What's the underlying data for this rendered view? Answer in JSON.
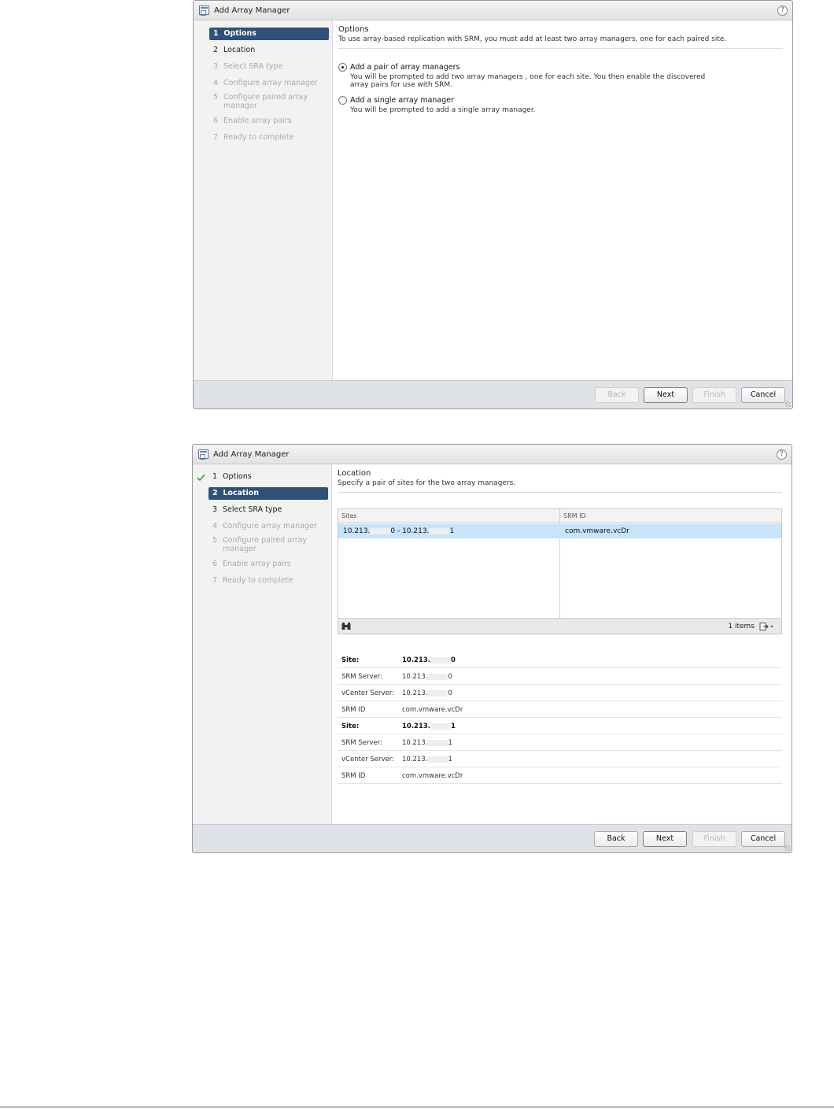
{
  "dialogs": [
    {
      "title": "Add Array Manager",
      "help_symbol": "?",
      "steps": [
        {
          "num": "1",
          "label": "Options"
        },
        {
          "num": "2",
          "label": "Location"
        },
        {
          "num": "3",
          "label": "Select SRA type"
        },
        {
          "num": "4",
          "label": "Configure array manager"
        },
        {
          "num": "5",
          "label": "Configure paired array manager"
        },
        {
          "num": "6",
          "label": "Enable array pairs"
        },
        {
          "num": "7",
          "label": "Ready to complete"
        }
      ],
      "section_title": "Options",
      "section_desc": "To use array-based replication with SRM, you must add at least two array managers, one for each paired site.",
      "options": [
        {
          "label": "Add a pair of array managers",
          "desc": "You will be prompted to add two array managers , one for each site. You then enable the discovered array pairs for use with SRM.",
          "checked": true
        },
        {
          "label": "Add a single array manager",
          "desc": "You will be prompted to add a single array manager.",
          "checked": false
        }
      ],
      "buttons": {
        "back": "Back",
        "next": "Next",
        "finish": "Finish",
        "cancel": "Cancel"
      }
    },
    {
      "title": "Add Array Manager",
      "help_symbol": "?",
      "steps": [
        {
          "num": "1",
          "label": "Options"
        },
        {
          "num": "2",
          "label": "Location"
        },
        {
          "num": "3",
          "label": "Select SRA type"
        },
        {
          "num": "4",
          "label": "Configure array manager"
        },
        {
          "num": "5",
          "label": "Configure paired array manager"
        },
        {
          "num": "6",
          "label": "Enable array pairs"
        },
        {
          "num": "7",
          "label": "Ready to complete"
        }
      ],
      "section_title": "Location",
      "section_desc": "Specify a pair of sites for the two array managers.",
      "grid": {
        "columns": [
          "Sites",
          "SRM ID"
        ],
        "row": {
          "site_a_prefix": "10.213.",
          "site_a_suffix": "0",
          "separator": " - ",
          "site_b_prefix": "10.213.",
          "site_b_suffix": "1",
          "srm_id": "com.vmware.vcDr"
        },
        "items_count": "1 items"
      },
      "details": [
        {
          "label": "Site:",
          "value_prefix": "10.213.",
          "value_suffix": "0"
        },
        {
          "label": "SRM Server:",
          "value_prefix": "10.213.",
          "value_suffix": "0"
        },
        {
          "label": "vCenter Server:",
          "value_prefix": "10.213.",
          "value_suffix": "0"
        },
        {
          "label": "SRM ID",
          "value_prefix": "com.vmware.vcDr",
          "value_suffix": ""
        },
        {
          "label": "Site:",
          "value_prefix": "10.213.",
          "value_suffix": "1"
        },
        {
          "label": "SRM Server:",
          "value_prefix": "10.213.",
          "value_suffix": "1"
        },
        {
          "label": "vCenter Server:",
          "value_prefix": "10.213.",
          "value_suffix": "1"
        },
        {
          "label": "SRM ID",
          "value_prefix": "com.vmware.vcDr",
          "value_suffix": ""
        }
      ],
      "buttons": {
        "back": "Back",
        "next": "Next",
        "finish": "Finish",
        "cancel": "Cancel"
      }
    }
  ],
  "colors": {
    "active_step": "#2f5079",
    "selected_row": "#c8e4f8",
    "check_green": "#3a9a3a"
  },
  "icons": {
    "title": "dialog-window-icon",
    "help": "help-icon",
    "completed_step": "checkmark-icon",
    "search": "binoculars-icon",
    "export": "export-icon"
  }
}
